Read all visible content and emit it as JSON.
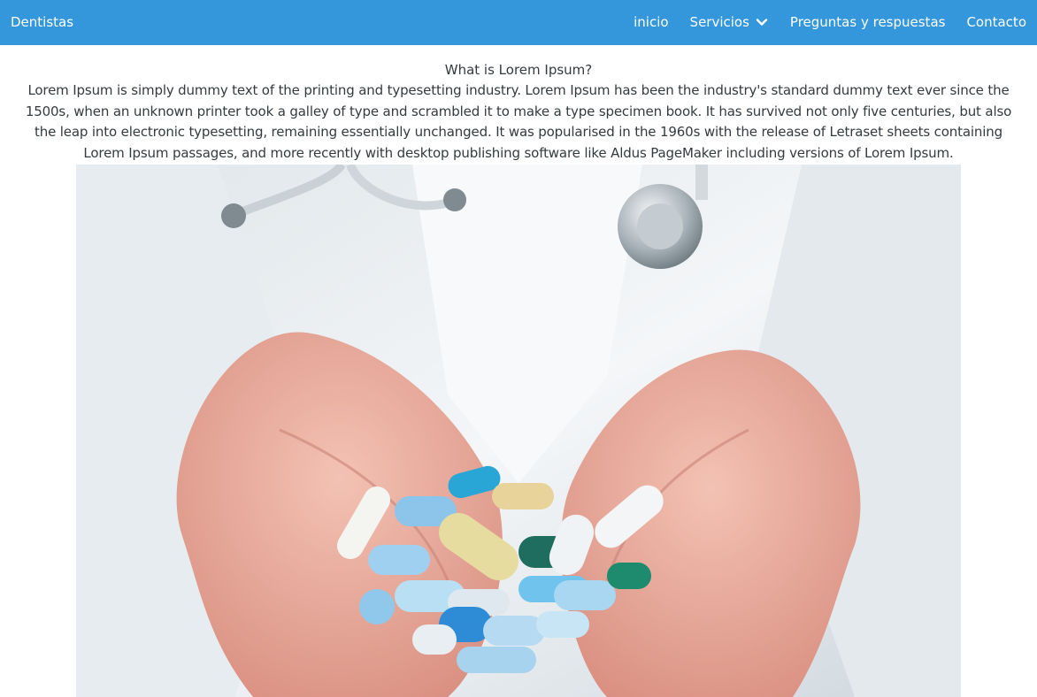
{
  "navbar": {
    "brand": "Dentistas",
    "links": [
      {
        "label": "inicio"
      },
      {
        "label": "Servicios",
        "icon": "chevron-down-icon"
      },
      {
        "label": "Preguntas y respuestas"
      },
      {
        "label": "Contacto"
      }
    ],
    "background_color": "#3497dc"
  },
  "main": {
    "title": "What is Lorem Ipsum?",
    "paragraph": "Lorem Ipsum is simply dummy text of the printing and typesetting industry. Lorem Ipsum has been the industry's standard dummy text ever since the 1500s, when an unknown printer took a galley of type and scrambled it to make a type specimen book. It has survived not only five centuries, but also the leap into electronic typesetting, remaining essentially unchanged. It was popularised in the 1960s with the release of Letraset sheets containing Lorem Ipsum passages, and more recently with desktop publishing software like Aldus PageMaker including versions of Lorem Ipsum."
  }
}
